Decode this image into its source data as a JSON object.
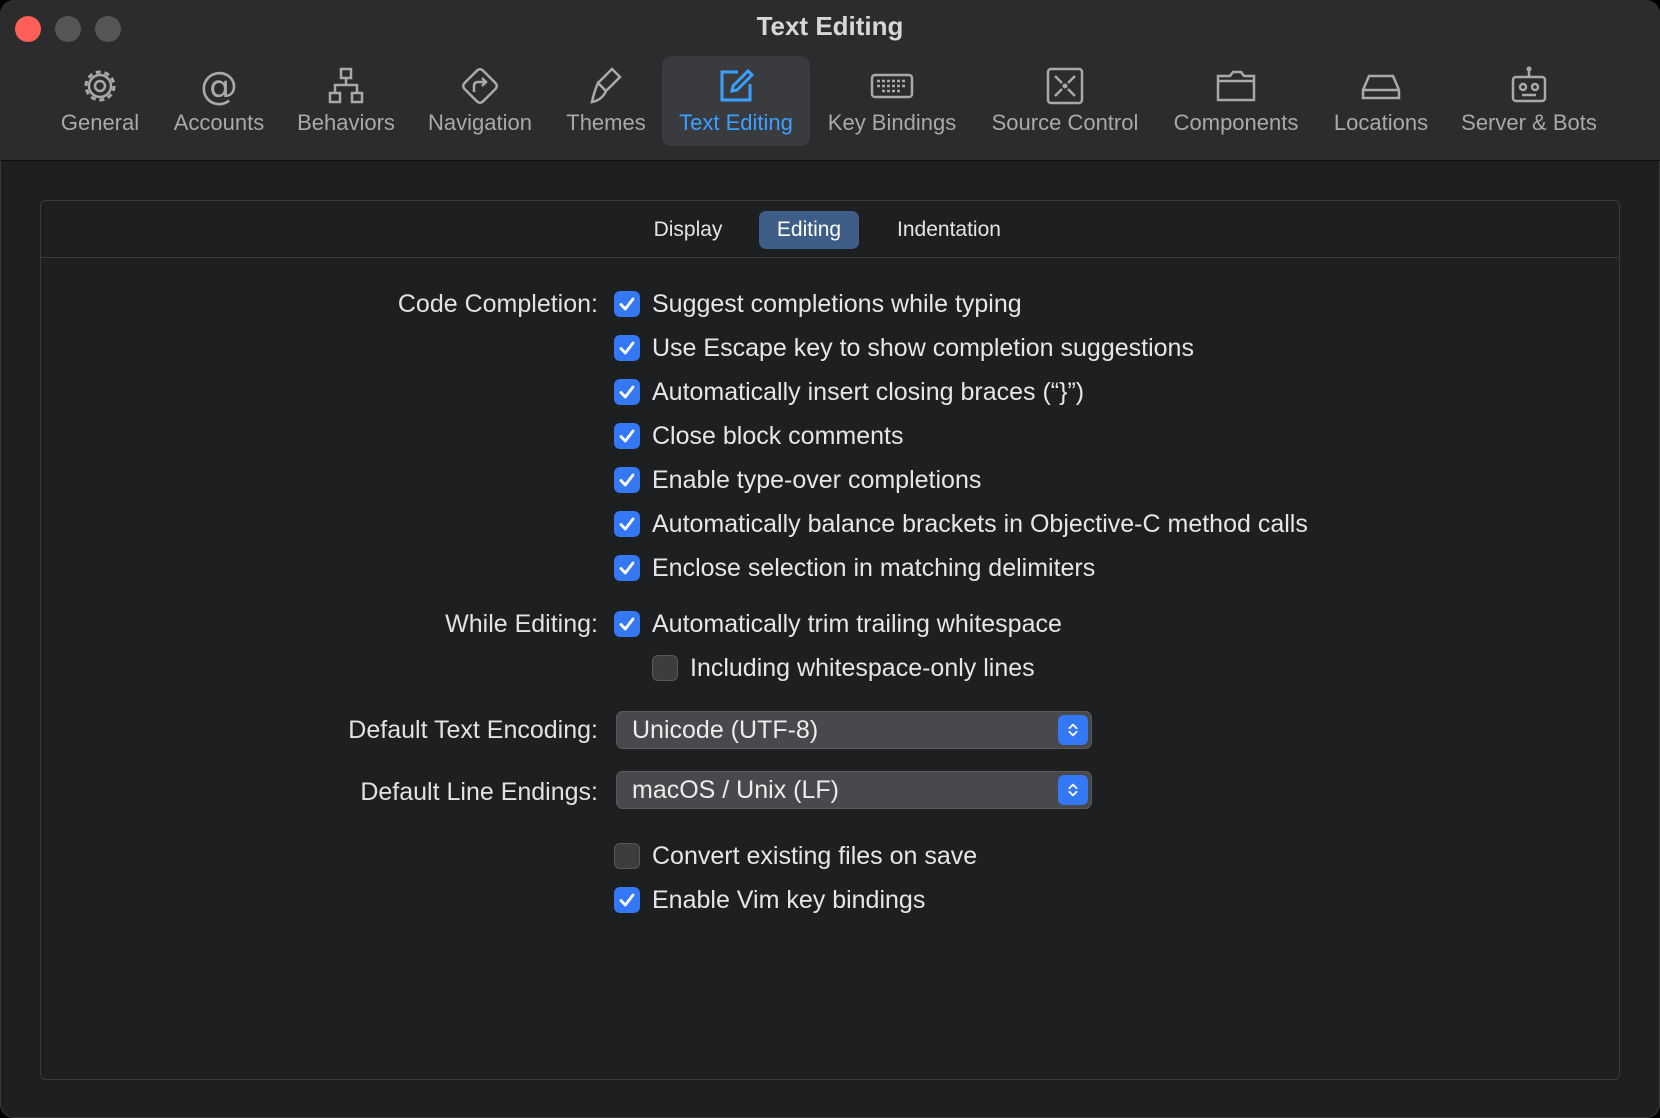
{
  "window": {
    "title": "Text Editing"
  },
  "toolbar": {
    "tabs": [
      {
        "label": "General",
        "icon": "gear-icon"
      },
      {
        "label": "Accounts",
        "icon": "at-icon"
      },
      {
        "label": "Behaviors",
        "icon": "hierarchy-icon"
      },
      {
        "label": "Navigation",
        "icon": "navigation-icon"
      },
      {
        "label": "Themes",
        "icon": "brush-icon"
      },
      {
        "label": "Text Editing",
        "icon": "edit-icon",
        "active": true
      },
      {
        "label": "Key Bindings",
        "icon": "keyboard-icon"
      },
      {
        "label": "Source Control",
        "icon": "source-control-icon"
      },
      {
        "label": "Components",
        "icon": "folder-icon"
      },
      {
        "label": "Locations",
        "icon": "drive-icon"
      },
      {
        "label": "Server & Bots",
        "icon": "robot-icon"
      }
    ]
  },
  "segments": {
    "items": [
      "Display",
      "Editing",
      "Indentation"
    ],
    "selected": "Editing"
  },
  "code_completion": {
    "label": "Code Completion:",
    "options": [
      {
        "text": "Suggest completions while typing",
        "checked": true
      },
      {
        "text": "Use Escape key to show completion suggestions",
        "checked": true
      },
      {
        "text": "Automatically insert closing braces (“}”)",
        "checked": true
      },
      {
        "text": "Close block comments",
        "checked": true
      },
      {
        "text": "Enable type-over completions",
        "checked": true
      },
      {
        "text": "Automatically balance brackets in Objective-C method calls",
        "checked": true
      },
      {
        "text": "Enclose selection in matching delimiters",
        "checked": true
      }
    ]
  },
  "while_editing": {
    "label": "While Editing:",
    "options": [
      {
        "text": "Automatically trim trailing whitespace",
        "checked": true
      },
      {
        "text": "Including whitespace-only lines",
        "checked": false
      }
    ]
  },
  "encoding": {
    "label": "Default Text Encoding:",
    "value": "Unicode (UTF-8)"
  },
  "line_endings": {
    "label": "Default Line Endings:",
    "value": "macOS / Unix (LF)"
  },
  "bottom_options": [
    {
      "text": "Convert existing files on save",
      "checked": false
    },
    {
      "text": "Enable Vim key bindings",
      "checked": true
    }
  ],
  "colors": {
    "accent": "#3478f6",
    "active_tab_text": "#3aa0ff",
    "segment_active": "#3e5e88"
  }
}
